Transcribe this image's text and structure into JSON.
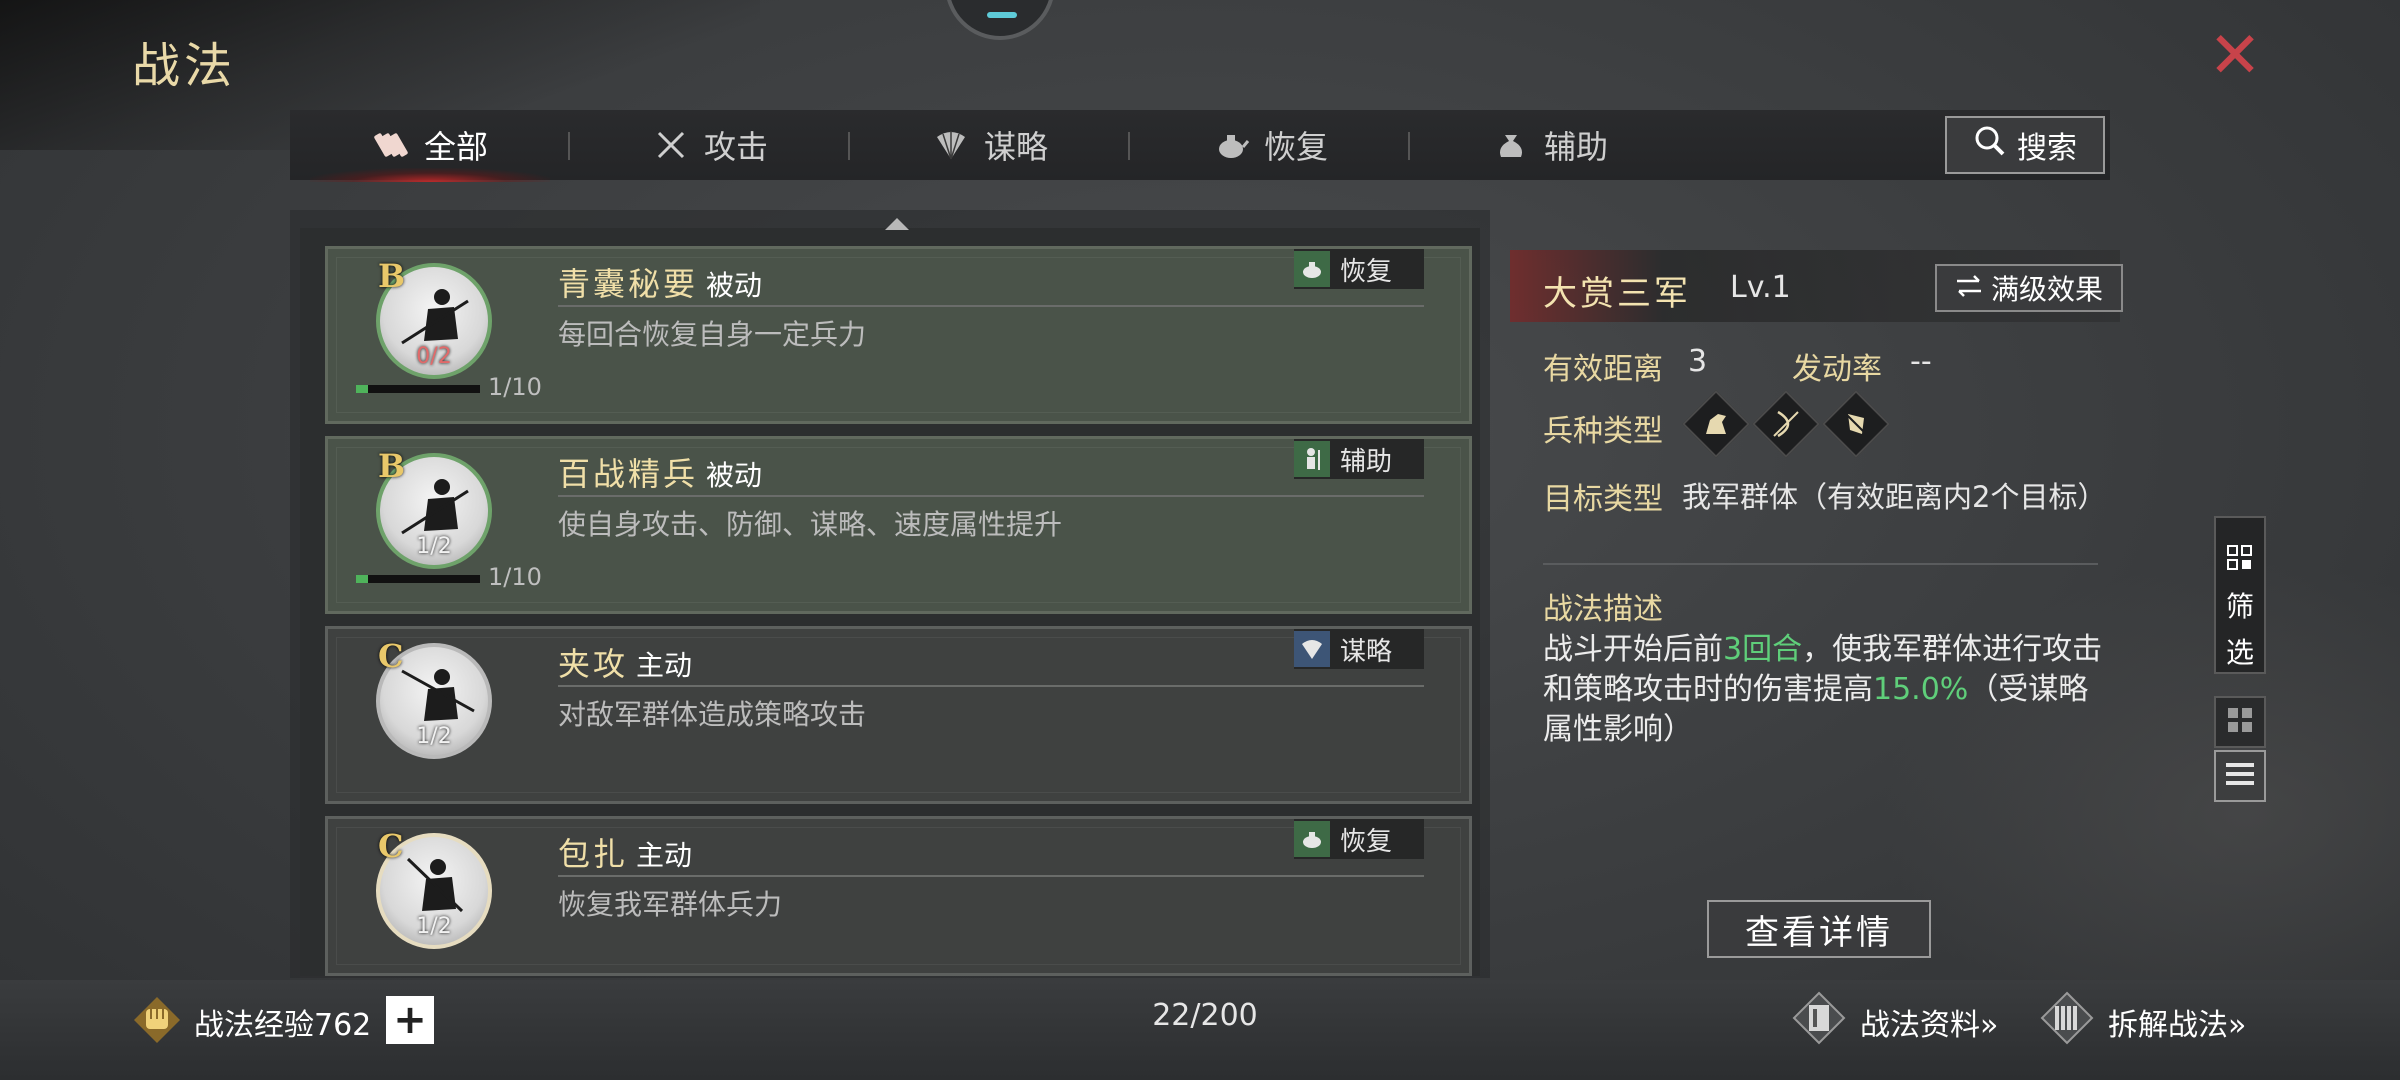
{
  "page": {
    "title": "战法"
  },
  "tabs": [
    {
      "label": "全部",
      "icon": "all-scroll-icon",
      "active": true
    },
    {
      "label": "攻击",
      "icon": "crossed-swords-icon",
      "active": false
    },
    {
      "label": "谋略",
      "icon": "fan-icon",
      "active": false
    },
    {
      "label": "恢复",
      "icon": "teapot-icon",
      "active": false
    },
    {
      "label": "辅助",
      "icon": "pouch-icon",
      "active": false
    }
  ],
  "search": {
    "label": "搜索",
    "icon": "search-icon"
  },
  "tactics": [
    {
      "grade": "B",
      "name": "青囊秘要",
      "kind": "被动",
      "desc": "每回合恢复自身一定兵力",
      "type": "恢复",
      "type_icon": "teapot-icon",
      "type_color": "#3e6a46",
      "count": "0/2",
      "count_warn": true,
      "level_text": "1/10",
      "level_fraction": 0.1,
      "highlighted": true
    },
    {
      "grade": "B",
      "name": "百战精兵",
      "kind": "被动",
      "desc": "使自身攻击、防御、谋略、速度属性提升",
      "type": "辅助",
      "type_icon": "soldier-icon",
      "type_color": "#3e6a46",
      "count": "1/2",
      "count_warn": false,
      "level_text": "1/10",
      "level_fraction": 0.1,
      "highlighted": true
    },
    {
      "grade": "C",
      "name": "夹攻",
      "kind": "主动",
      "desc": "对敌军群体造成策略攻击",
      "type": "谋略",
      "type_icon": "fan-icon",
      "type_color": "#3d5576",
      "count": "1/2",
      "count_warn": false,
      "level_text": "",
      "level_fraction": null,
      "highlighted": false
    },
    {
      "grade": "C",
      "name": "包扎",
      "kind": "主动",
      "desc": "恢复我军群体兵力",
      "type": "恢复",
      "type_icon": "teapot-icon",
      "type_color": "#3e6a46",
      "count": "1/2",
      "count_warn": false,
      "level_text": "",
      "level_fraction": null,
      "highlighted": false
    }
  ],
  "detail": {
    "name": "大赏三军",
    "level": "Lv.1",
    "max_button": "满级效果",
    "range_label": "有效距离",
    "range_value": "3",
    "rate_label": "发动率",
    "rate_value": "--",
    "troop_label": "兵种类型",
    "troop_icons": [
      "cavalry-icon",
      "archer-icon",
      "infantry-icon"
    ],
    "target_label": "目标类型",
    "target_value": "我军群体（有效距离内2个目标）",
    "desc_title": "战法描述",
    "desc_parts": {
      "p1": "战斗开始后前",
      "h1": "3回合",
      "p2": "，使我军群体进行攻击和策略攻击时的伤害提高",
      "h2": "15.0%",
      "p3": "（受谋略属性影响）"
    },
    "view_button": "查看详情"
  },
  "side": {
    "filter_label_1": "筛",
    "filter_label_2": "选"
  },
  "footer": {
    "exp_label": "战法经验762",
    "plus": "+",
    "count": "22/200",
    "link_info": "战法资料»",
    "link_disassemble": "拆解战法»"
  },
  "colors": {
    "accent_gold": "#e8d8a2",
    "highlight_green": "#5fcf7a",
    "close_red": "#c8434a"
  }
}
